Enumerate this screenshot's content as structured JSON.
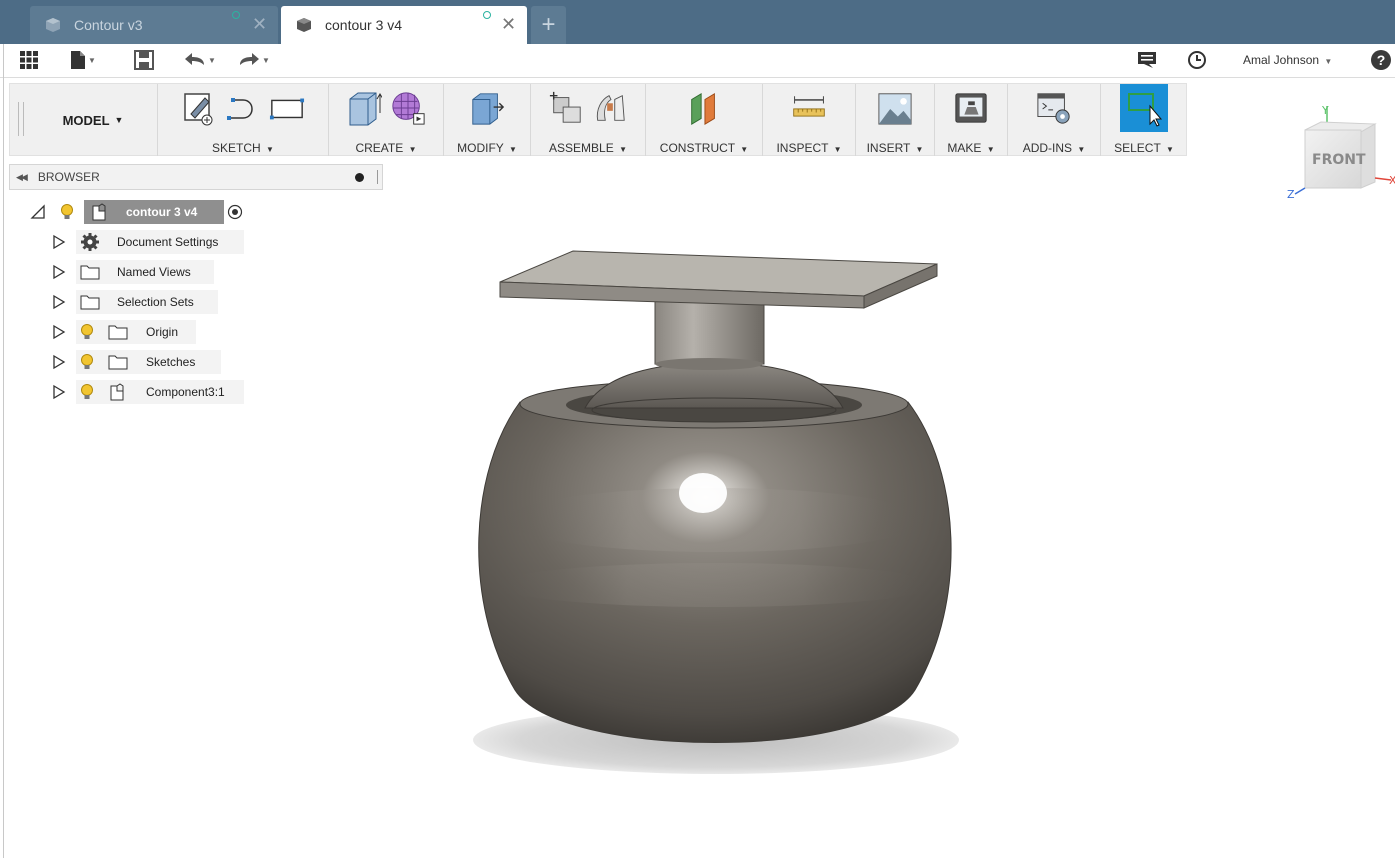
{
  "tabs": [
    {
      "label": "Contour v3",
      "active": false
    },
    {
      "label": "contour 3 v4",
      "active": true
    }
  ],
  "quick_access": {
    "user_name": "Amal Johnson",
    "help": "?"
  },
  "toolbar": {
    "workspace": "MODEL",
    "groups": [
      {
        "label": "SKETCH"
      },
      {
        "label": "CREATE"
      },
      {
        "label": "MODIFY"
      },
      {
        "label": "ASSEMBLE"
      },
      {
        "label": "CONSTRUCT"
      },
      {
        "label": "INSPECT"
      },
      {
        "label": "INSERT"
      },
      {
        "label": "MAKE"
      },
      {
        "label": "ADD-INS"
      },
      {
        "label": "SELECT"
      }
    ]
  },
  "browser": {
    "title": "BROWSER",
    "root": "contour 3 v4",
    "items": [
      {
        "label": "Document Settings",
        "icon": "gear-icon"
      },
      {
        "label": "Named Views",
        "icon": "folder-icon"
      },
      {
        "label": "Selection Sets",
        "icon": "folder-icon"
      },
      {
        "label": "Origin",
        "icon": "folder-icon"
      },
      {
        "label": "Sketches",
        "icon": "folder-icon"
      },
      {
        "label": "Component3:1",
        "icon": "component-icon"
      }
    ]
  },
  "viewcube": {
    "face": "FRONT",
    "axis_y": "Y",
    "axis_z": "Z",
    "axis_x": "X"
  },
  "colors": {
    "tabbar": "#4d6c86",
    "select_active": "#1a8fd6",
    "model_metal": "#6e6a64"
  }
}
